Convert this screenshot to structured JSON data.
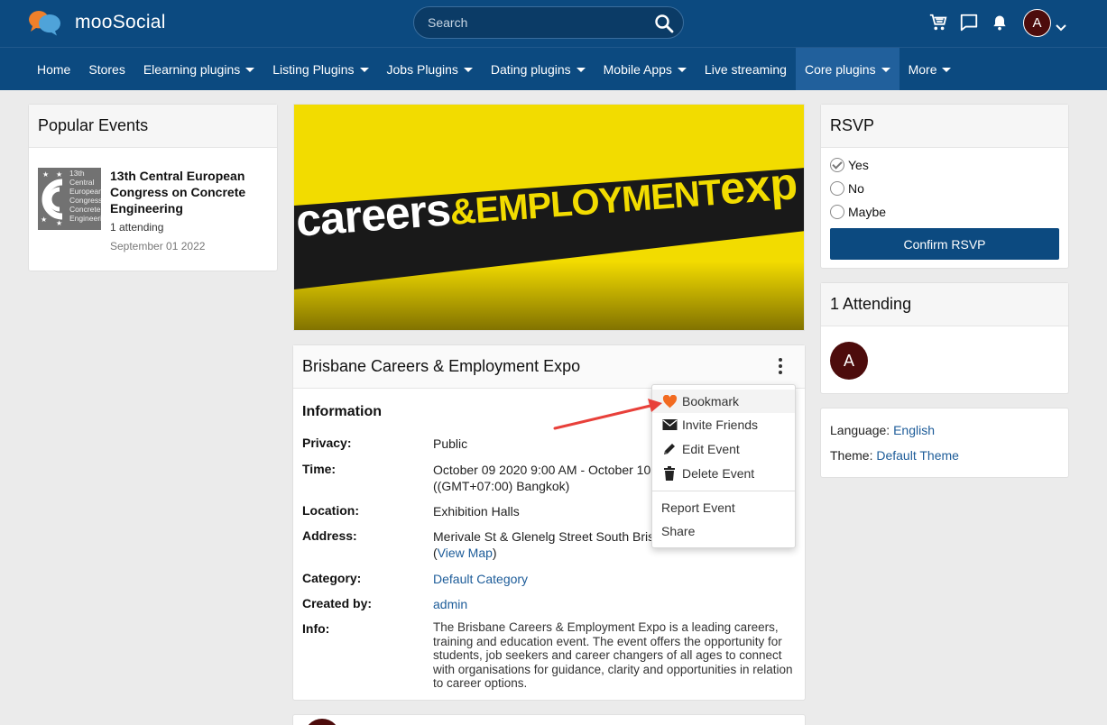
{
  "header": {
    "brand": "mooSocial",
    "search_placeholder": "Search",
    "avatar_initial": "A",
    "icons": [
      "cart-icon",
      "chat-icon",
      "bell-icon",
      "search-icon"
    ]
  },
  "nav": [
    {
      "label": "Home",
      "dropdown": false
    },
    {
      "label": "Stores",
      "dropdown": false
    },
    {
      "label": "Elearning plugins",
      "dropdown": true
    },
    {
      "label": "Listing Plugins",
      "dropdown": true
    },
    {
      "label": "Jobs Plugins",
      "dropdown": true
    },
    {
      "label": "Dating plugins",
      "dropdown": true
    },
    {
      "label": "Mobile Apps",
      "dropdown": true
    },
    {
      "label": "Live streaming",
      "dropdown": false
    },
    {
      "label": "Core plugins",
      "dropdown": true,
      "active": true
    },
    {
      "label": "More",
      "dropdown": true
    }
  ],
  "popular": {
    "title": "Popular Events",
    "item": {
      "title": "13th Central European Congress on Concrete Engineering",
      "attending": "1 attending",
      "date": "September 01 2022",
      "thumb_lines": [
        "13th",
        "Central",
        "European",
        "Congress",
        "Concrete",
        "Engineering"
      ]
    }
  },
  "banner": {
    "text_a": "careers",
    "text_b": "&EMPLOYMENT",
    "text_c": "exp"
  },
  "event": {
    "title": "Brisbane Careers & Employment Expo",
    "info_heading": "Information",
    "privacy_label": "Privacy:",
    "privacy": "Public",
    "time_label": "Time:",
    "time_line1": "October 09 2020 9:00 AM - October 10 2",
    "time_line2": "((GMT+07:00) Bangkok)",
    "location_label": "Location:",
    "location": "Exhibition Halls",
    "address_label": "Address:",
    "address": "Merivale St & Glenelg Street South Brisb",
    "view_map_open": "(",
    "view_map": "View Map",
    "view_map_close": ")",
    "category_label": "Category:",
    "category": "Default Category",
    "created_label": "Created by:",
    "created_by": "admin",
    "info_label": "Info:",
    "info": "The Brisbane Careers & Employment Expo is a leading careers, training and education event. The event offers the opportunity for students, job seekers and career changers of all ages to connect with organisations for guidance, clarity and opportunities in relation to career options."
  },
  "menu": {
    "bookmark": "Bookmark",
    "invite": "Invite Friends",
    "edit": "Edit Event",
    "delete": "Delete Event",
    "report": "Report Event",
    "share": "Share"
  },
  "rsvp": {
    "title": "RSVP",
    "options": [
      "Yes",
      "No",
      "Maybe"
    ],
    "selected": "Yes",
    "confirm": "Confirm RSVP"
  },
  "attending": {
    "title": "1 Attending",
    "avatar_initial": "A"
  },
  "settings": {
    "language_label": "Language:",
    "language": "English",
    "theme_label": "Theme:",
    "theme": "Default Theme"
  },
  "colors": {
    "header_bg": "#0c4a80",
    "active_nav": "#21609c",
    "accent": "#1d5c99",
    "bookmark": "#f26b21",
    "annotation_arrow": "#e8403a"
  }
}
